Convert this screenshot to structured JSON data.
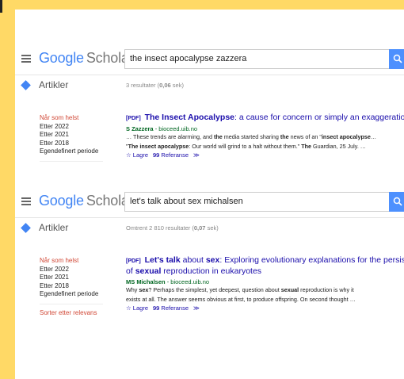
{
  "panels": [
    {
      "logo": {
        "google": "Google",
        "scholar": "Scholar"
      },
      "query": "the insect apocalypse zazzera",
      "section": "Artikler",
      "count": {
        "prefix": "3 resultater (",
        "time": "0,06",
        "suffix": " sek)"
      },
      "filters": [
        "Når som helst",
        "Etter 2022",
        "Etter 2021",
        "Etter 2018",
        "Egendefinert periode"
      ],
      "result": {
        "tag": "[PDF]",
        "title_b1": "The Insect Apocalypse",
        "title_r1": ": a cause for concern or simply an exaggeration?",
        "author": "S Zazzera",
        "source": " - bioceed.uib.no",
        "snippet1_a": "… These trends are alarming, and ",
        "snippet1_b": "the",
        "snippet1_c": " media started sharing ",
        "snippet1_d": "the",
        "snippet1_e": " news of an \"",
        "snippet1_f": "insect apocalypse",
        "snippet1_g": "…",
        "snippet2_a": "\"",
        "snippet2_b": "The insect apocalypse",
        "snippet2_c": ": Our world will grind to a halt without them.\" ",
        "snippet2_d": "The",
        "snippet2_e": " Guardian, 25 July. …",
        "save": "☆ Lagre",
        "cite": "𝟗𝟗 Referanse",
        "more": "≫"
      }
    },
    {
      "logo": {
        "google": "Google",
        "scholar": "Scholar"
      },
      "query": "let's talk about sex michalsen",
      "section": "Artikler",
      "count": {
        "prefix": "Omtrent 2 810 resultater (",
        "time": "0,07",
        "suffix": " sek)"
      },
      "filters": [
        "Når som helst",
        "Etter 2022",
        "Etter 2021",
        "Etter 2018",
        "Egendefinert periode"
      ],
      "sort": "Sorter etter relevans",
      "result": {
        "tag": "[PDF]",
        "title_b1": "Let's talk",
        "title_r1": " about ",
        "title_b2": "sex",
        "title_r2": ": Exploring evolutionary explanations for the persistence",
        "title_r3": "of ",
        "title_b3": "sexual",
        "title_r4": " reproduction in eukaryotes",
        "author": "MS Michalsen",
        "source": " - bioceed.uib.no",
        "snippet1_a": "Why ",
        "snippet1_b": "sex",
        "snippet1_c": "? Perhaps the simplest, yet deepest, question about ",
        "snippet1_d": "sexual",
        "snippet1_e": " reproduction is why it",
        "snippet2": "exists at all. The answer seems obvious at first, to produce offspring. On second thought …",
        "save": "☆ Lagre",
        "cite": "𝟗𝟗 Referanse",
        "more": "≫"
      }
    }
  ]
}
